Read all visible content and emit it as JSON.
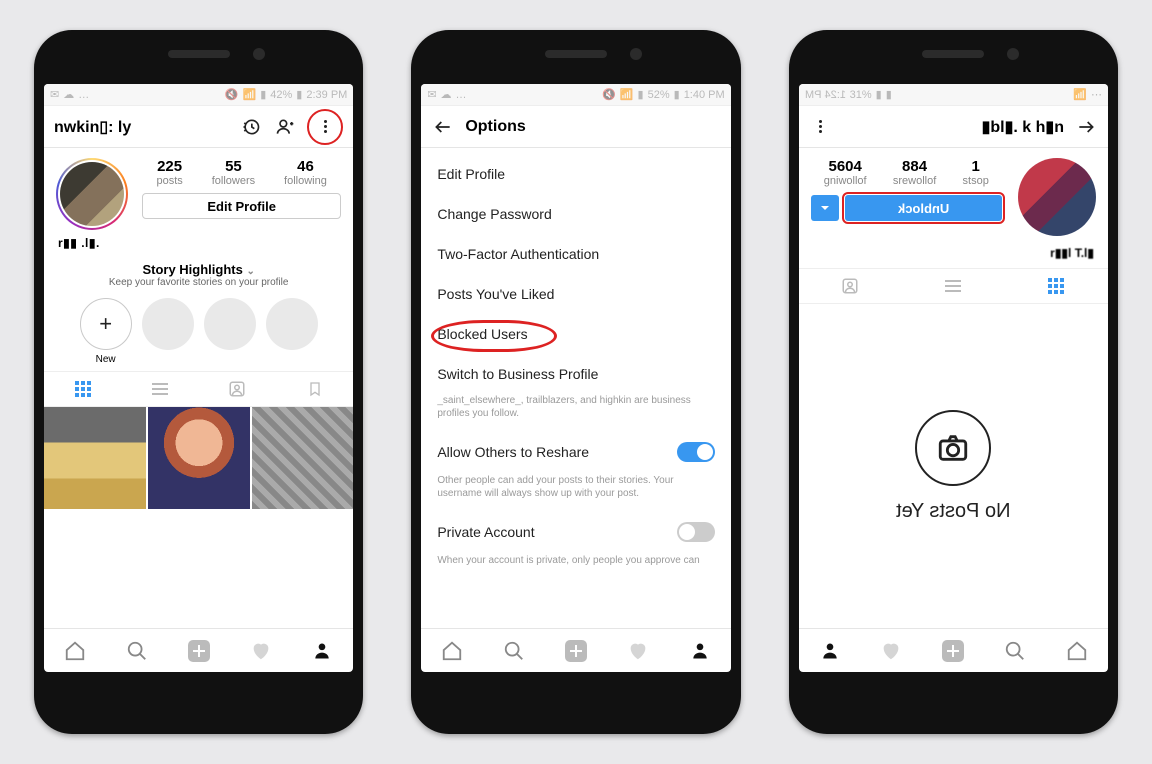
{
  "phone1": {
    "status": {
      "battery_pct": "42%",
      "time": "2:39 PM"
    },
    "username": "nwkin▯: ly ",
    "stats": {
      "posts": {
        "n": "225",
        "l": "posts"
      },
      "followers": {
        "n": "55",
        "l": "followers"
      },
      "following": {
        "n": "46",
        "l": "following"
      }
    },
    "edit_profile": "Edit Profile",
    "bio": "r▮▮ .l▮.",
    "highlights": {
      "title": "Story Highlights",
      "subtitle": "Keep your favorite stories on your profile",
      "new_label": "New"
    }
  },
  "phone2": {
    "status": {
      "battery_pct": "52%",
      "time": "1:40 PM"
    },
    "title": "Options",
    "items": {
      "edit_profile": "Edit Profile",
      "change_password": "Change Password",
      "two_factor": "Two-Factor Authentication",
      "posts_liked": "Posts You've Liked",
      "blocked_users": "Blocked Users",
      "switch_business": "Switch to Business Profile",
      "switch_business_desc": "_saint_elsewhere_, trailblazers, and highkin are business profiles you follow.",
      "reshare": "Allow Others to Reshare",
      "reshare_desc": "Other people can add your posts to their stories. Your username will always show up with your post.",
      "private": "Private Account",
      "private_desc": "When your account is private, only people you approve can"
    }
  },
  "phone3": {
    "status": {
      "battery_pct": "31%",
      "time": "4:21 PM"
    },
    "username": "▮bl▮. k  h▮n",
    "stats": {
      "following": {
        "n": "5604",
        "l": "gniwollof"
      },
      "followers": {
        "n": "884",
        "l": "srewollof"
      },
      "posts": {
        "n": "1",
        "l": "stsop"
      }
    },
    "unblock": "Unblock",
    "bio": "r▮▮l T.l▮",
    "no_posts": "No Posts Yet"
  }
}
